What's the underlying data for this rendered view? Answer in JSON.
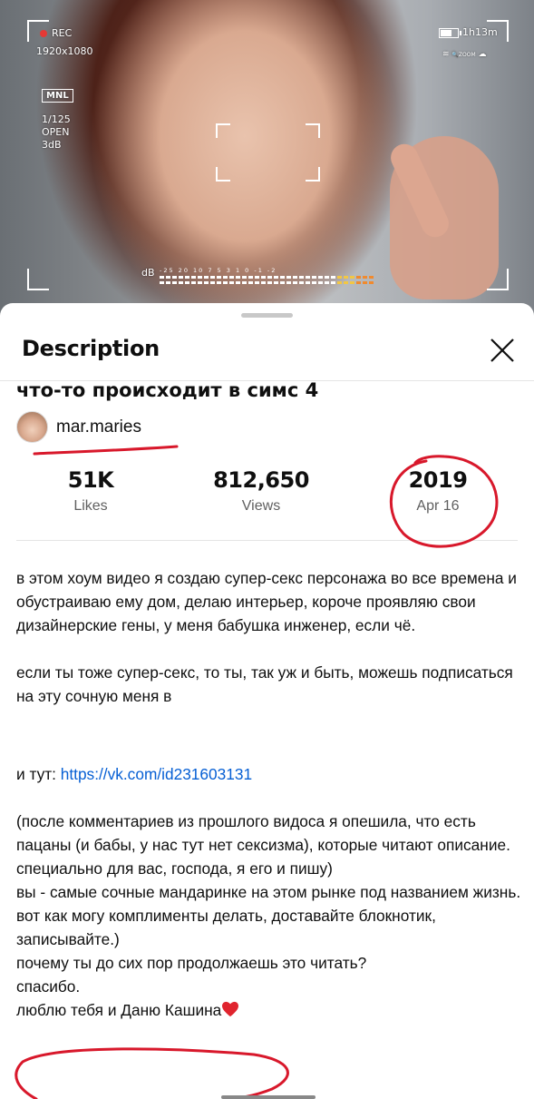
{
  "video_overlay": {
    "rec_label": "REC",
    "resolution": "1920x1080",
    "mode": "MNL",
    "shutter": "1/125",
    "aperture": "OPEN",
    "gain": "3dB",
    "battery_time": "1h13m",
    "zoom_label": "ZOOM",
    "meter_label": "dB",
    "meter_scale": "-25  20  10  7  5  3  1  0  -1  -2"
  },
  "sheet": {
    "title": "Description",
    "close_icon": "close-x-icon"
  },
  "video": {
    "title": "что-то происходит в симс 4",
    "channel": "mar.maries"
  },
  "stats": {
    "likes": {
      "value": "51K",
      "label": "Likes"
    },
    "views": {
      "value": "812,650",
      "label": "Views"
    },
    "date": {
      "value": "2019",
      "label": "Apr 16"
    }
  },
  "description": {
    "p1": "в этом хоум видео я создаю супер-секс персонажа во все времена и обустраиваю ему дом, делаю интерьер, короче проявляю свои дизайнерские гены, у меня бабушка инженер, если чё.",
    "p2": "если ты тоже супер-секс, то ты, так уж и быть, можешь подписаться на эту сочную меня в",
    "link_prefix": "и тут: ",
    "link": "https://vk.com/id231603131",
    "p3": "(после комментариев из прошлого видоса я опешила, что есть пацаны (и бабы, у нас тут нет сексизма), которые читают описание. специально для вас, господа, я его и пишу)",
    "p4": "вы - самые сочные мандаринке на этом рынке под названием жизнь.",
    "p5": "вот как могу комплименты делать, доставайте блокнотик, записывайте.)",
    "p6": "почему ты до сих пор продолжаешь это читать?",
    "p7": "спасибо.",
    "p8": "люблю тебя и Даню Кашина"
  },
  "colors": {
    "link": "#065fd4",
    "annotation": "#d8182b",
    "heart": "#e0242e"
  }
}
